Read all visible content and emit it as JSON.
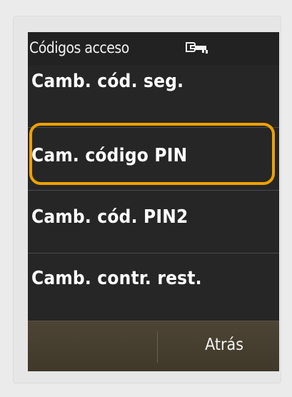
{
  "status_bar": {
    "title": "Códigos acceso",
    "icon": "key-icon"
  },
  "menu": {
    "items": [
      {
        "label": "Camb. cód. seg."
      },
      {
        "label": "Cam. código PIN",
        "focused": true
      },
      {
        "label": "Camb. cód. PIN2"
      },
      {
        "label": "Camb. contr. rest."
      }
    ]
  },
  "softkeys": {
    "left_label": "",
    "right_label": "Atrás"
  },
  "colors": {
    "focus": "#f0a000",
    "background": "#262626",
    "softkey_bar": "#463d2f",
    "text": "#ffffff"
  }
}
